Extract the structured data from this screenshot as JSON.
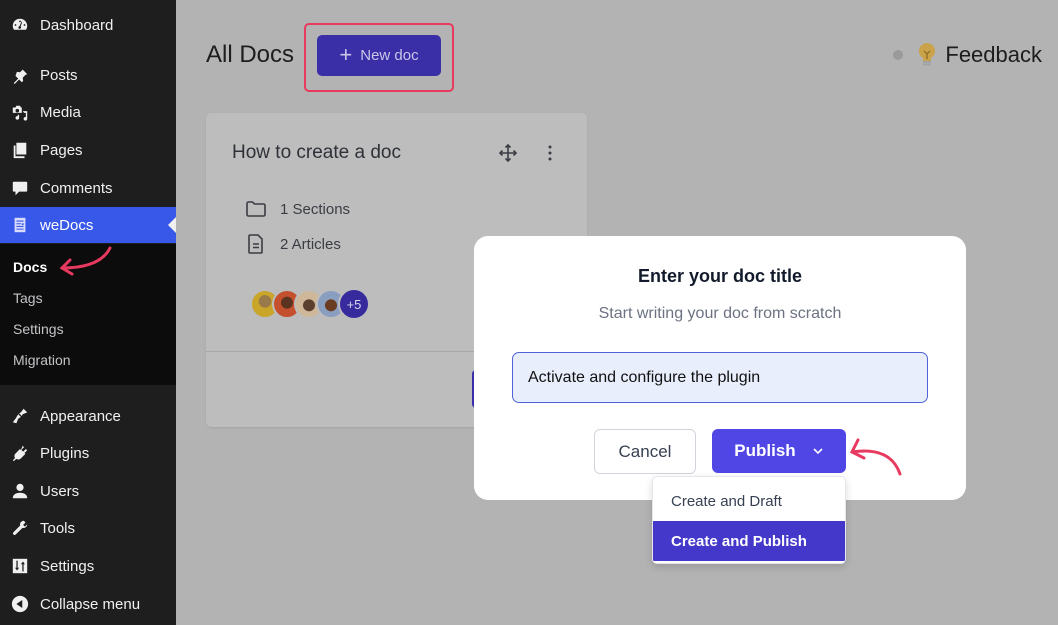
{
  "sidebar": {
    "items": [
      {
        "label": "Dashboard",
        "icon": "dashboard-icon"
      },
      {
        "label": "Posts",
        "icon": "pin-icon"
      },
      {
        "label": "Media",
        "icon": "media-icon"
      },
      {
        "label": "Pages",
        "icon": "pages-icon"
      },
      {
        "label": "Comments",
        "icon": "comment-icon"
      },
      {
        "label": "weDocs",
        "icon": "document-icon",
        "active": true
      },
      {
        "label": "Appearance",
        "icon": "paintbrush-icon"
      },
      {
        "label": "Plugins",
        "icon": "plug-icon"
      },
      {
        "label": "Users",
        "icon": "user-icon"
      },
      {
        "label": "Tools",
        "icon": "wrench-icon"
      },
      {
        "label": "Settings",
        "icon": "sliders-icon"
      },
      {
        "label": "Collapse menu",
        "icon": "collapse-icon"
      }
    ],
    "submenu": [
      {
        "label": "Docs",
        "current": true
      },
      {
        "label": "Tags"
      },
      {
        "label": "Settings"
      },
      {
        "label": "Migration"
      }
    ]
  },
  "header": {
    "title": "All Docs",
    "new_doc_label": "New doc",
    "feedback_label": "Feedback"
  },
  "doc_card": {
    "title": "How to create a doc",
    "sections": "1 Sections",
    "articles": "2 Articles",
    "contributors_more": "+5"
  },
  "modal": {
    "title": "Enter your doc title",
    "subtitle": "Start writing your doc from scratch",
    "input_value": "Activate and configure the plugin",
    "cancel_label": "Cancel",
    "publish_label": "Publish",
    "dropdown": [
      {
        "label": "Create and Draft"
      },
      {
        "label": "Create and Publish",
        "selected": true
      }
    ]
  },
  "colors": {
    "accent": "#4f46e5",
    "wp_active": "#3858e9",
    "annotation": "#e8395f"
  }
}
